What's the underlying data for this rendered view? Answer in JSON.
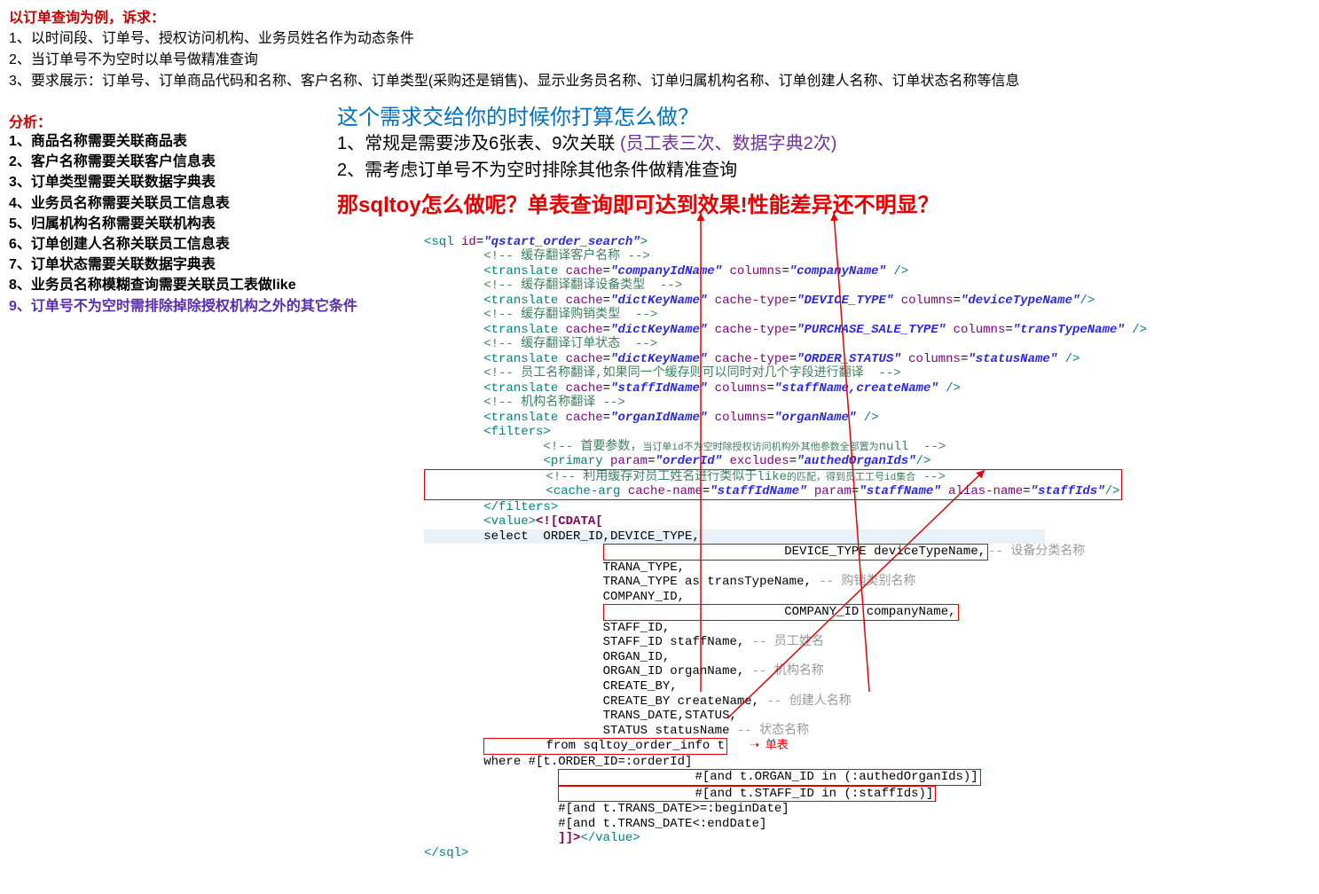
{
  "top": {
    "title": "以订单查询为例，诉求：",
    "items": [
      "1、以时间段、订单号、授权访问机构、业务员姓名作为动态条件",
      "2、当订单号不为空时以单号做精准查询",
      "3、要求展示：订单号、订单商品代码和名称、客户名称、订单类型(采购还是销售)、显示业务员名称、订单归属机构名称、订单创建人名称、订单状态名称等信息"
    ]
  },
  "analysis": {
    "title": "分析：",
    "items": [
      "1、商品名称需要关联商品表",
      "2、客户名称需要关联客户信息表",
      "3、订单类型需要关联数据字典表",
      "4、业务员名称需要关联员工信息表",
      "5、归属机构名称需要关联机构表",
      "6、订单创建人名称关联员工信息表",
      "7、订单状态需要关联数据字典表",
      "8、业务员名称模糊查询需要关联员工表做like",
      "9、订单号不为空时需排除掉除授权机构之外的其它条件"
    ]
  },
  "right": {
    "blue": "这个需求交给你的时候你打算怎么做？",
    "line1a": "1、常规是需要涉及6张表、9次关联 ",
    "line1b": "(员工表三次、数据字典2次)",
    "line2": "2、需考虑订单号不为空时排除其他条件做精准查询",
    "red": "那sqltoy怎么做呢？单表查询即可达到效果!性能差异还不明显？"
  },
  "code": {
    "l1a": "<sql ",
    "l1b": "id",
    "l1c": "=",
    "l1d": "\"qstart_order_search\"",
    "l1e": ">",
    "l2": "\t<!-- 缓存翻译客户名称 -->",
    "l3a": "\t<translate ",
    "l3b": "cache",
    "l3c": "=",
    "l3d": "\"companyIdName\"",
    "l3e": " columns",
    "l3f": "=",
    "l3g": "\"companyName\"",
    "l3h": " />",
    "l4": "\t<!-- 缓存翻译翻译设备类型  -->",
    "l5a": "\t<translate ",
    "l5b": "cache",
    "l5c": "=",
    "l5d": "\"dictKeyName\"",
    "l5e": " cache-type",
    "l5f": "=",
    "l5g": "\"DEVICE_TYPE\"",
    "l5h": " columns",
    "l5i": "=",
    "l5j": "\"deviceTypeName\"",
    "l5k": "/>",
    "l6": "\t<!-- 缓存翻译购销类型  -->",
    "l7a": "\t<translate ",
    "l7b": "cache",
    "l7c": "=",
    "l7d": "\"dictKeyName\"",
    "l7e": " cache-type",
    "l7f": "=",
    "l7g": "\"PURCHASE_SALE_TYPE\"",
    "l7h": " columns",
    "l7i": "=",
    "l7j": "\"transTypeName\"",
    "l7k": " />",
    "l8": "\t<!-- 缓存翻译订单状态  -->",
    "l9a": "\t<translate ",
    "l9b": "cache",
    "l9c": "=",
    "l9d": "\"dictKeyName\"",
    "l9e": " cache-type",
    "l9f": "=",
    "l9g": "\"ORDER_STATUS\"",
    "l9h": " columns",
    "l9i": "=",
    "l9j": "\"statusName\"",
    "l9k": " />",
    "l10": "\t<!-- 员工名称翻译,如果同一个缓存则可以同时对几个字段进行翻译  -->",
    "l11a": "\t<translate ",
    "l11b": "cache",
    "l11c": "=",
    "l11d": "\"staffIdName\"",
    "l11e": " columns",
    "l11f": "=",
    "l11g": "\"staffName,createName\"",
    "l11h": " />",
    "l12": "\t<!-- 机构名称翻译 -->",
    "l13a": "\t<translate ",
    "l13b": "cache",
    "l13c": "=",
    "l13d": "\"organIdName\"",
    "l13e": " columns",
    "l13f": "=",
    "l13g": "\"organName\"",
    "l13h": " />",
    "l14": "\t<filters>",
    "l15a": "\t\t<!-- 首要参数，",
    "l15b": "当订单id不为空时除授权访问机构外其他参数全部置为",
    "l15c": "null  -->",
    "l16a": "\t\t<primary ",
    "l16b": "param",
    "l16c": "=",
    "l16d": "\"orderId\"",
    "l16e": " excludes",
    "l16f": "=",
    "l16g": "\"authedOrganIds\"",
    "l16h": "/>",
    "l17a": "\t\t<!-- 利用缓存对员工姓名进行类似于like",
    "l17b": "的匹配，得到员工工号id集合",
    "l17c": " -->",
    "l18a": "\t\t<cache-arg ",
    "l18b": "cache-name",
    "l18c": "=",
    "l18d": "\"staffIdName\"",
    "l18e": " param",
    "l18f": "=",
    "l18g": "\"staffName\"",
    "l18h": " alias-name",
    "l18i": "=",
    "l18j": "\"staffIds\"",
    "l18k": "/>",
    "l19": "\t</filters>",
    "l20a": "\t<value>",
    "l20b": "<![CDATA[",
    "l21": "\tselect  ORDER_ID,DEVICE_TYPE,",
    "l22a": "\t\t\tDEVICE_TYPE deviceTypeName,",
    "l22b": "-- 设备分类名称",
    "l23": "\t\t\tTRANA_TYPE,",
    "l24a": "\t\t\tTRANA_TYPE as transTypeName, ",
    "l24b": "-- 购销类别名称",
    "l25": "\t\t\tCOMPANY_ID,",
    "l26": "\t\t\tCOMPANY_ID companyName,",
    "l27": "\t\t\tSTAFF_ID,",
    "l28a": "\t\t\tSTAFF_ID staffName, ",
    "l28b": "-- 员工姓名",
    "l29": "\t\t\tORGAN_ID,",
    "l30a": "\t\t\tORGAN_ID organName, ",
    "l30b": "-- 机构名称",
    "l31": "\t\t\tCREATE_BY,",
    "l32a": "\t\t\tCREATE_BY createName, ",
    "l32b": "-- 创建人名称",
    "l33": "\t\t\tTRANS_DATE,STATUS,",
    "l34a": "\t\t\tSTATUS statusName ",
    "l34b": "-- 状态名称",
    "l35": "\tfrom sqltoy_order_info t",
    "l35annot": "单表",
    "l36": "\twhere #[t.ORDER_ID=:orderId]",
    "l37": "\t\t  #[and t.ORGAN_ID in (:authedOrganIds)]",
    "l38": "\t\t  #[and t.STAFF_ID in (:staffIds)]",
    "l39": "\t\t  #[and t.TRANS_DATE>=:beginDate]",
    "l40": "\t\t  #[and t.TRANS_DATE<:endDate]",
    "l41a": "\t\t  ]]>",
    "l41b": "</value>",
    "l42": "</sql>"
  }
}
